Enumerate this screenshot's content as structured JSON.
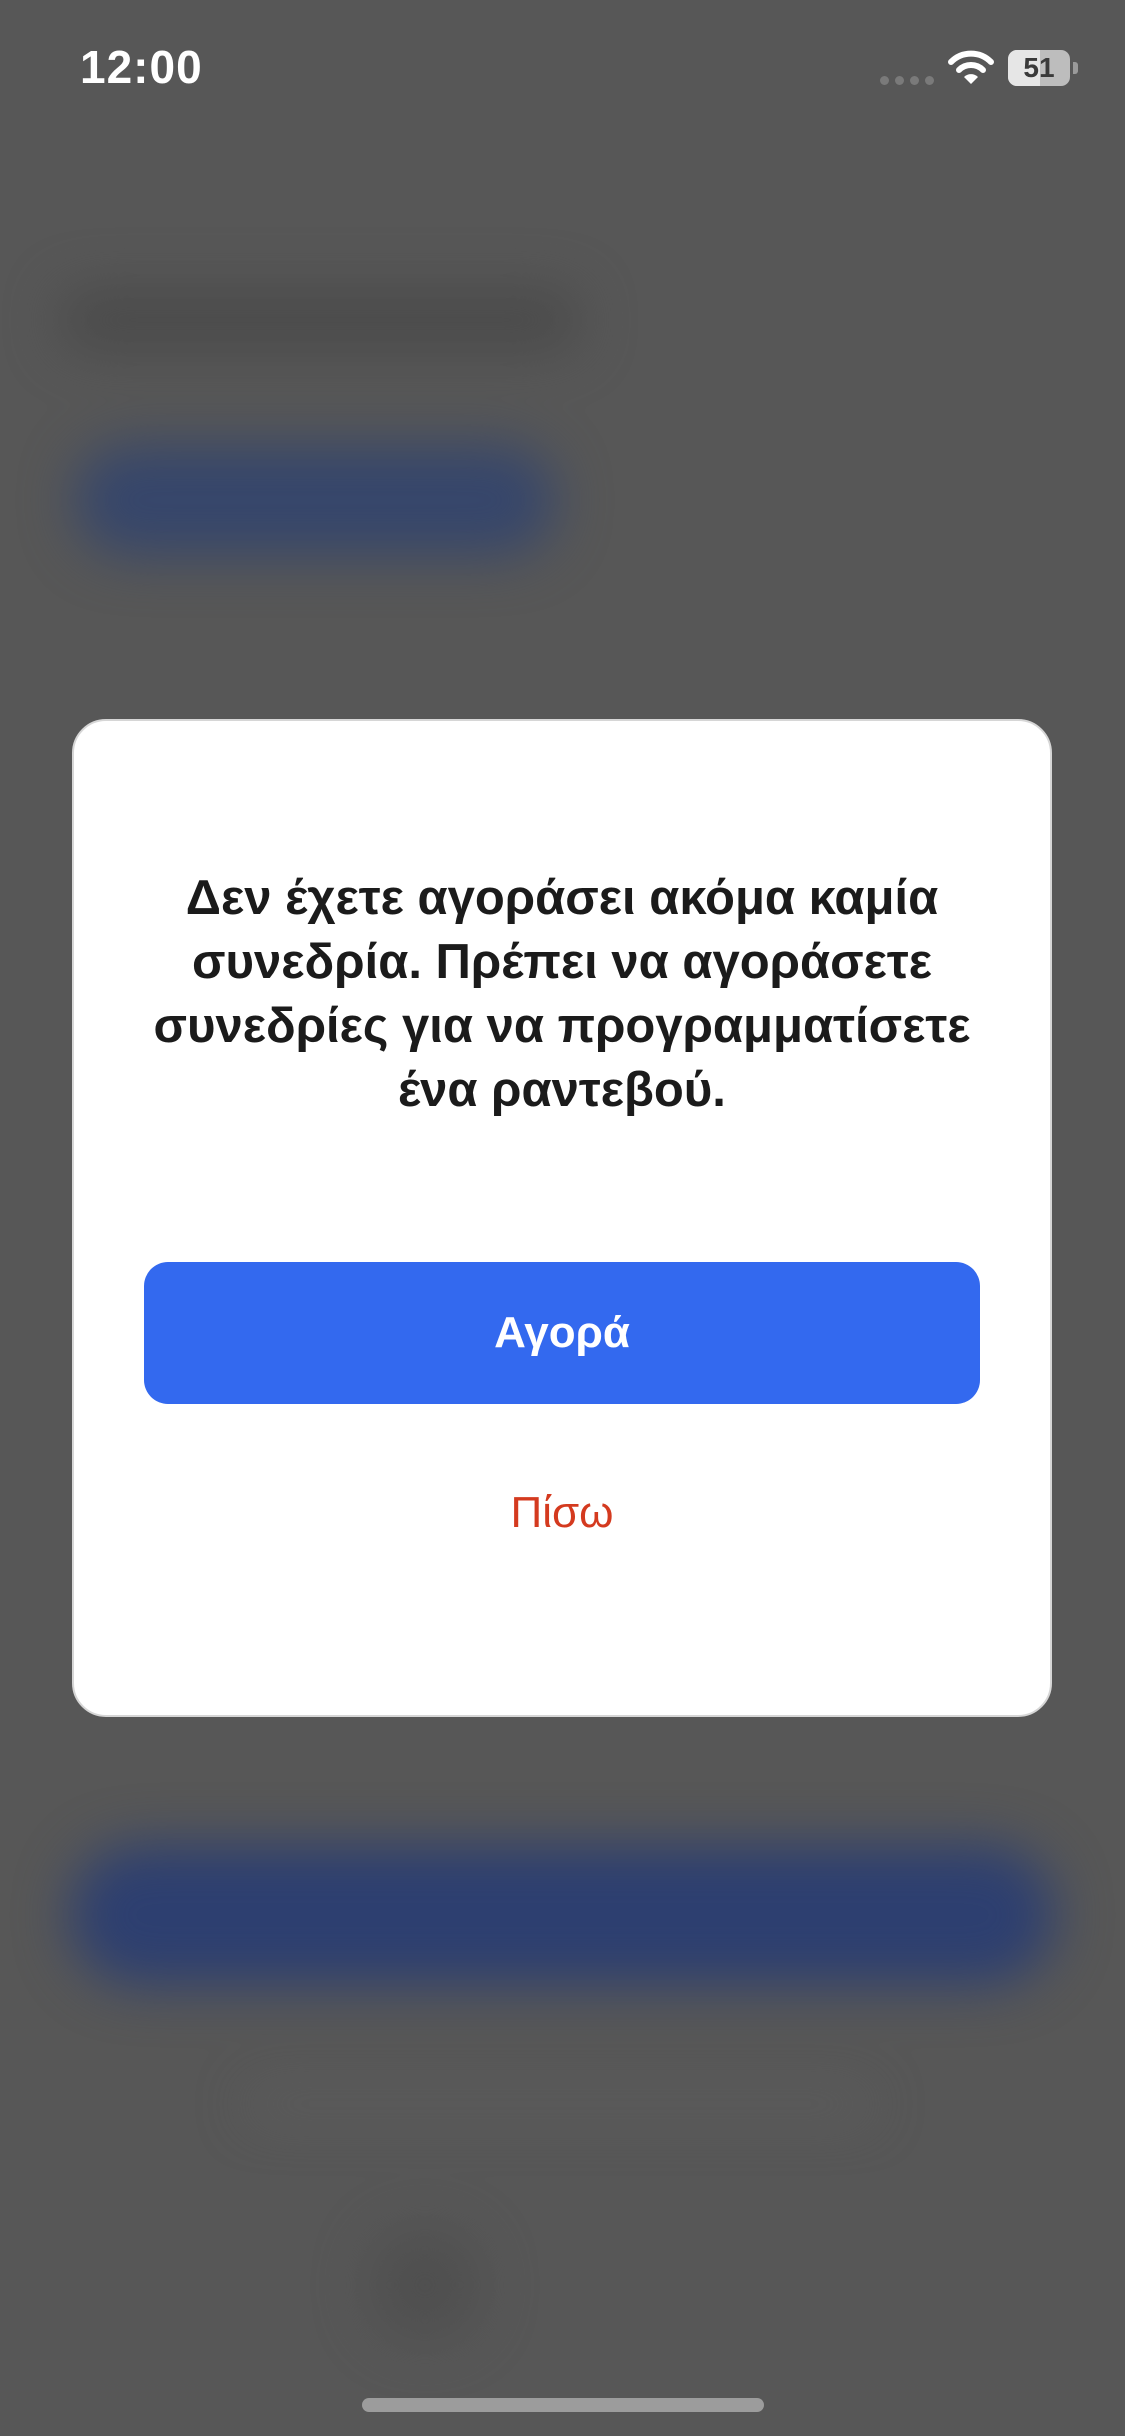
{
  "status_bar": {
    "time": "12:00",
    "battery_level": "51",
    "battery_fraction": 0.51,
    "icons": [
      "signal-icon",
      "wifi-icon",
      "battery-icon"
    ]
  },
  "dialog": {
    "message": "Δεν έχετε αγοράσει ακόμα καμία συνεδρία. Πρέπει να αγοράσετε συνεδρίες για να προγραμματίσετε ένα ραντεβού.",
    "primary_button_label": "Αγορά",
    "secondary_button_label": "Πίσω"
  },
  "colors": {
    "overlay": "#575757",
    "dialog_background": "#ffffff",
    "primary_button": "#3369ef",
    "secondary_text": "#d43a1f",
    "message_text": "#1b1b1b"
  }
}
